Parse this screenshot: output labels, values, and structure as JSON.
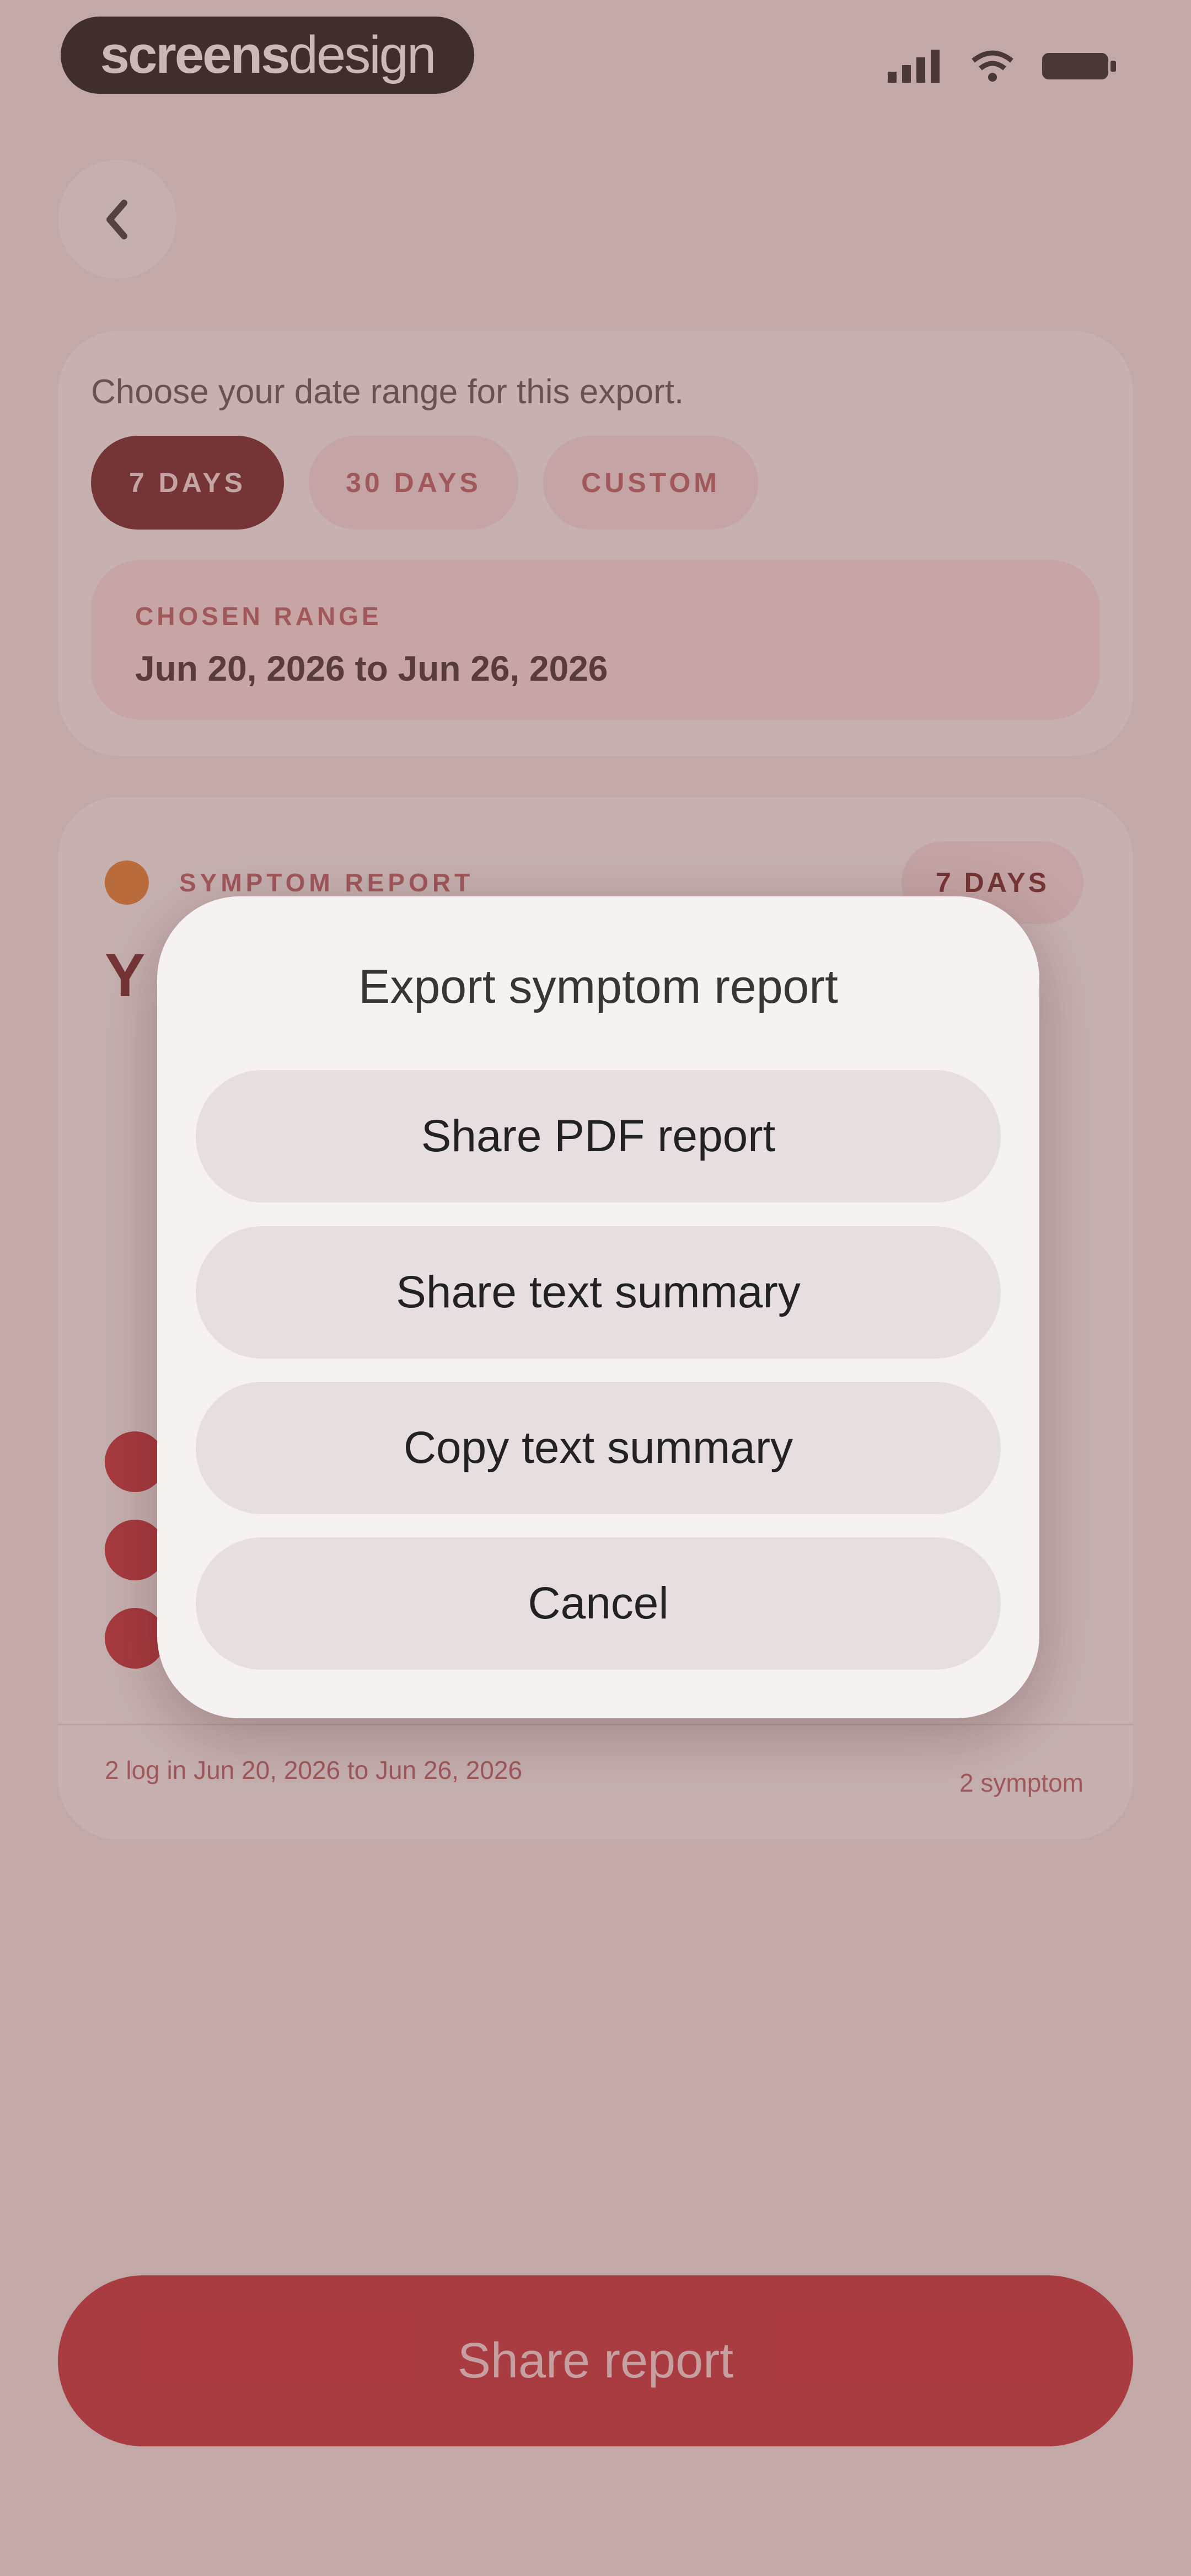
{
  "brand": {
    "bold": "screens",
    "light": "design"
  },
  "date_card": {
    "hint": "Choose your date range for this export.",
    "chips": [
      "7 DAYS",
      "30 DAYS",
      "CUSTOM"
    ],
    "range_label": "CHOSEN RANGE",
    "range_value": "Jun 20, 2026 to Jun 26, 2026"
  },
  "report_card": {
    "label": "SYMPTOM REPORT",
    "badge": "7 DAYS",
    "heading_partial": "Y",
    "footer_left": "2 log in Jun 20, 2026 to Jun 26, 2026",
    "footer_right": "2 symptom"
  },
  "share_button": "Share report",
  "dialog": {
    "title": "Export symptom report",
    "options": [
      "Share PDF report",
      "Share text summary",
      "Copy text summary",
      "Cancel"
    ]
  },
  "colors": {
    "accent": "#c52a31",
    "dark_accent": "#6b1e22",
    "orange_dot": "#e07a2a"
  }
}
